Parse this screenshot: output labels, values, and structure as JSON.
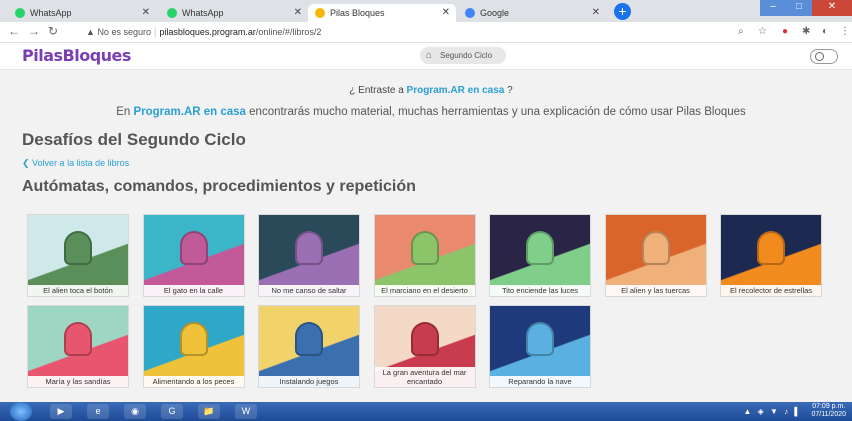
{
  "browser": {
    "tabs": [
      {
        "title": "WhatsApp",
        "favicon_color": "#25d366"
      },
      {
        "title": "WhatsApp",
        "favicon_color": "#25d366"
      },
      {
        "title": "Pilas Bloques",
        "favicon_color": "#f5b700"
      },
      {
        "title": "Google",
        "favicon_color": "#4285f4"
      }
    ],
    "new_tab": "+",
    "security_label": "No es seguro",
    "url_host": "pilasbloques.program.ar",
    "url_path": "/online/#/libros/2"
  },
  "app": {
    "logo": "PilasBloques",
    "breadcrumb": "Segundo Ciclo"
  },
  "promo": {
    "question_pre": "¿ Entraste a ",
    "question_link": "Program.AR en casa",
    "question_post": " ?",
    "line_pre": "En ",
    "line_link": "Program.AR en casa",
    "line_post": " encontrarás mucho material, muchas herramientas y una explicación de cómo usar Pilas Bloques"
  },
  "page": {
    "title": "Desafíos del Segundo Ciclo",
    "back_link": "Volver a la lista de libros",
    "section_title": "Autómatas, comandos, procedimientos y repetición"
  },
  "challenges": [
    {
      "label": "El alien toca el botón",
      "colors": [
        "#cfe8ea",
        "#5a8f5a"
      ]
    },
    {
      "label": "El gato en la calle",
      "colors": [
        "#3bb6c8",
        "#c25a9a"
      ]
    },
    {
      "label": "No me canso de saltar",
      "colors": [
        "#2a4a5a",
        "#9b6fb4"
      ]
    },
    {
      "label": "El marciano en el desierto",
      "colors": [
        "#e98a6f",
        "#8cc46a"
      ]
    },
    {
      "label": "Tito enciende las luces",
      "colors": [
        "#2a2446",
        "#7fcf8a"
      ]
    },
    {
      "label": "El alien y las tuercas",
      "colors": [
        "#d9652a",
        "#f0b079"
      ]
    },
    {
      "label": "El recolector de estrellas",
      "colors": [
        "#1c2a52",
        "#f28b1e"
      ]
    },
    {
      "label": "María y las sandías",
      "colors": [
        "#9dd6c2",
        "#e8556e"
      ]
    },
    {
      "label": "Alimentando a los peces",
      "colors": [
        "#2fa7c9",
        "#f0c23a"
      ]
    },
    {
      "label": "Instalando juegos",
      "colors": [
        "#f2d36b",
        "#3a6fb0"
      ]
    },
    {
      "label": "La gran aventura del mar encantado",
      "colors": [
        "#f4d9c6",
        "#c93b4e"
      ]
    },
    {
      "label": "Reparando la nave",
      "colors": [
        "#1e3a7a",
        "#5ab0e0"
      ]
    }
  ],
  "taskbar": {
    "apps": [
      "▶",
      "e",
      "◉",
      "G",
      "📁",
      "W"
    ],
    "time": "07:09 p.m.",
    "date": "07/11/2020"
  }
}
